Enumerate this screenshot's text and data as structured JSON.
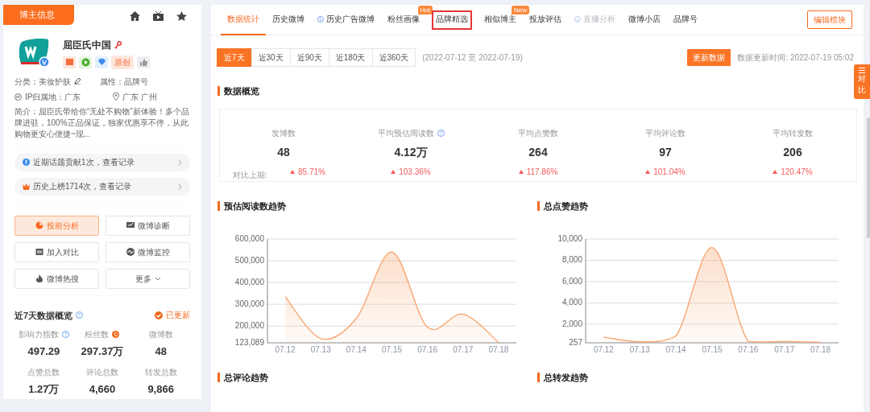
{
  "profile": {
    "header_tab": "博主信息",
    "name": "屈臣氏中国",
    "badges": [
      {
        "kind": "shop"
      },
      {
        "kind": "play"
      },
      {
        "kind": "diamond"
      },
      {
        "kind": "tag",
        "text": "原创"
      },
      {
        "kind": "thumb"
      }
    ],
    "category": "分类：美妆护肤",
    "attribute": "属性：品牌号",
    "ip": "IP归属地：广东",
    "location": "广东 广州",
    "bio": "简介：屈臣氏带给你“无处不购物”新体验！多个品牌进驻，100%正品保证，独家优惠享不停，从此购物更安心便捷~现...",
    "records": [
      {
        "kind": "topic",
        "text": "近期话题贡献1次，查看记录"
      },
      {
        "kind": "rank",
        "text": "历史上榜1714次，查看记录"
      }
    ],
    "actions": [
      {
        "kind": "pie",
        "label": "投前分析",
        "selected": true
      },
      {
        "kind": "monitor",
        "label": "微博诊断",
        "selected": false
      },
      {
        "kind": "compare",
        "label": "加入对比",
        "selected": false
      },
      {
        "kind": "pulse",
        "label": "微博监控",
        "selected": false
      },
      {
        "kind": "fire",
        "label": "微博热搜",
        "selected": false
      },
      {
        "kind": "more",
        "label": "更多",
        "selected": false
      }
    ],
    "overview": {
      "title": "近7天数据概览",
      "status": "已更新",
      "stats": [
        {
          "kind": "help",
          "label": "影响力指数",
          "value": "497.29"
        },
        {
          "kind": "refresh",
          "label": "粉丝数",
          "value": "297.37万"
        },
        {
          "kind": "plain",
          "label": "微博数",
          "value": "48"
        },
        {
          "kind": "plain",
          "label": "点赞总数",
          "value": "1.27万"
        },
        {
          "kind": "plain",
          "label": "评论总数",
          "value": "4,660"
        },
        {
          "kind": "plain",
          "label": "转发总数",
          "value": "9,866"
        }
      ]
    }
  },
  "tabs": [
    {
      "label": "数据统计",
      "kind": "plain",
      "selected": true,
      "disabled": false,
      "highlighted": false
    },
    {
      "label": "历史微博",
      "kind": "plain",
      "selected": false,
      "disabled": false,
      "highlighted": false
    },
    {
      "label": "历史广告微博",
      "kind": "info",
      "selected": false,
      "disabled": false,
      "highlighted": false
    },
    {
      "label": "粉丝画像",
      "kind": "plain",
      "badge": "Hot",
      "selected": false,
      "disabled": false,
      "highlighted": false
    },
    {
      "label": "品牌精选",
      "kind": "plain",
      "selected": false,
      "disabled": false,
      "highlighted": true
    },
    {
      "label": "相似博主",
      "kind": "plain",
      "badge": "New",
      "selected": false,
      "disabled": false,
      "highlighted": false
    },
    {
      "label": "投放评估",
      "kind": "plain",
      "selected": false,
      "disabled": false,
      "highlighted": false
    },
    {
      "label": "直播分析",
      "kind": "info",
      "selected": false,
      "disabled": true,
      "highlighted": false
    },
    {
      "label": "微博小店",
      "kind": "plain",
      "selected": false,
      "disabled": false,
      "highlighted": false
    },
    {
      "label": "品牌号",
      "kind": "plain",
      "selected": false,
      "disabled": false,
      "highlighted": false
    }
  ],
  "edit_button": "编辑模块",
  "ranges": [
    {
      "label": "近7天",
      "selected": true
    },
    {
      "label": "近30天",
      "selected": false
    },
    {
      "label": "近90天",
      "selected": false
    },
    {
      "label": "近180天",
      "selected": false
    },
    {
      "label": "近360天",
      "selected": false
    }
  ],
  "date_range": "(2022-07-12 至 2022-07-19)",
  "refresh_button": "更新数据",
  "update_time": "数据更新时间: 2022-07-19 05:02",
  "compare_tab": "对比",
  "summary": {
    "title": "数据概览",
    "compare_label": "对比上期:",
    "metrics": [
      {
        "label": "发博数",
        "value": "48",
        "change": "85.71%"
      },
      {
        "label": "平均预估阅读数",
        "help": true,
        "value": "4.12万",
        "change": "103.36%"
      },
      {
        "label": "平均点赞数",
        "value": "264",
        "change": "117.86%"
      },
      {
        "label": "平均评论数",
        "value": "97",
        "change": "101.04%"
      },
      {
        "label": "平均转发数",
        "value": "206",
        "change": "120.47%"
      }
    ]
  },
  "charts": [
    {
      "title": "预估阅读数趋势",
      "chart_data": {
        "type": "area",
        "categories": [
          "07.12",
          "07.13",
          "07.14",
          "07.15",
          "07.16",
          "07.17",
          "07.18"
        ],
        "grid": true,
        "series": [
          {
            "color": "#f7a26a",
            "values": [
              335000,
              143000,
              235000,
              540000,
              195000,
              255000,
              125000
            ]
          }
        ],
        "ylim": [
          123089,
          600000
        ],
        "yticks": [
          {
            "value": 123089,
            "label": "123,089"
          },
          {
            "value": 200000,
            "label": "200,000"
          },
          {
            "value": 300000,
            "label": "300,000"
          },
          {
            "value": 400000,
            "label": "400,000"
          },
          {
            "value": 500000,
            "label": "500,000"
          },
          {
            "value": 600000,
            "label": "600,000"
          }
        ]
      }
    },
    {
      "title": "总点赞趋势",
      "chart_data": {
        "type": "area",
        "categories": [
          "07.12",
          "07.13",
          "07.14",
          "07.15",
          "07.16",
          "07.17",
          "07.18"
        ],
        "grid": true,
        "series": [
          {
            "color": "#f7a26a",
            "values": [
              800,
              350,
              900,
              9200,
              400,
              380,
              300
            ]
          }
        ],
        "ylim": [
          257,
          10000
        ],
        "yticks": [
          {
            "value": 257,
            "label": "257"
          },
          {
            "value": 2000,
            "label": "2,000"
          },
          {
            "value": 4000,
            "label": "4,000"
          },
          {
            "value": 6000,
            "label": "6,000"
          },
          {
            "value": 8000,
            "label": "8,000"
          },
          {
            "value": 10000,
            "label": "10,000"
          }
        ]
      }
    }
  ],
  "more_sections": [
    "总评论趋势",
    "总转发趋势"
  ]
}
